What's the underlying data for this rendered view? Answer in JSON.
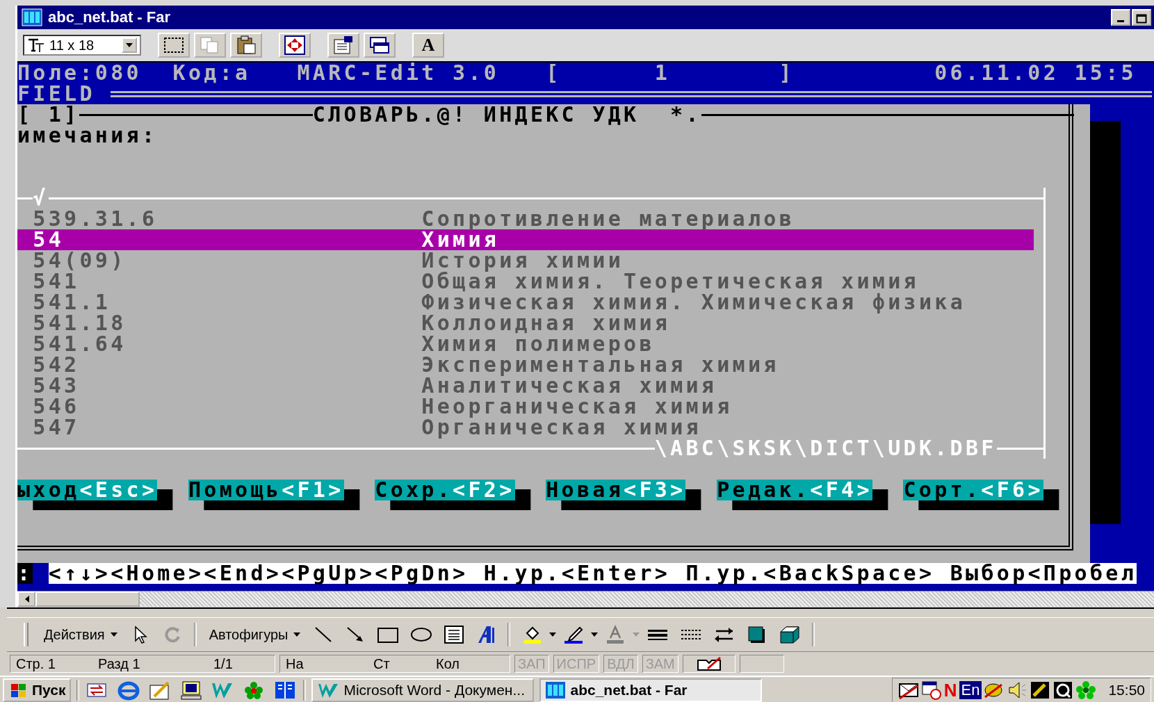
{
  "window": {
    "title": "abc_net.bat - Far",
    "font_size": "11 x 18",
    "font_button": "A"
  },
  "console": {
    "header": {
      "field": "Поле:080",
      "code": "Код:a",
      "app": "MARC-Edit 3.0",
      "bracket_open": "[",
      "record": "1",
      "bracket_close": "]",
      "datetime": "06.11.02 15:5"
    },
    "field_label": "FIELD",
    "dialog": {
      "number": "[ 1]",
      "title": "СЛОВАРЬ.@! ИНДЕКС УДК",
      "filter": "*.",
      "prompt": "имечания:",
      "mark": "√",
      "path": "\\ABC\\SKSK\\DICT\\UDK.DBF",
      "items": [
        {
          "code": "539.31.6",
          "name": "Сопротивление материалов",
          "selected": false
        },
        {
          "code": "54",
          "name": "Химия",
          "selected": true
        },
        {
          "code": "54(09)",
          "name": "История химии",
          "selected": false
        },
        {
          "code": "541",
          "name": "Общая химия. Теоретическая химия",
          "selected": false
        },
        {
          "code": "541.1",
          "name": "Физическая химия. Химическая физика",
          "selected": false
        },
        {
          "code": "541.18",
          "name": "Коллоидная химия",
          "selected": false
        },
        {
          "code": "541.64",
          "name": "Химия полимеров",
          "selected": false
        },
        {
          "code": "542",
          "name": "Экспериментальная химия",
          "selected": false
        },
        {
          "code": "543",
          "name": "Аналитическая химия",
          "selected": false
        },
        {
          "code": "546",
          "name": "Неорганическая химия",
          "selected": false
        },
        {
          "code": "547",
          "name": "Органическая химия",
          "selected": false
        }
      ],
      "buttons": [
        {
          "label": "ыход",
          "key": "<Esc>"
        },
        {
          "label": "Помощь",
          "key": "<F1>"
        },
        {
          "label": "Сохр.",
          "key": "<F2>"
        },
        {
          "label": "Новая",
          "key": "<F3>"
        },
        {
          "label": "Редак.",
          "key": "<F4>"
        },
        {
          "label": "Сорт.",
          "key": "<F6>"
        }
      ]
    },
    "hint": {
      "prompt": ":",
      "keys": "<↑↓><Home><End><PgUp><PgDn> Н.ур.<Enter> П.ур.<BackSpace> Выбор<Пробел"
    }
  },
  "word": {
    "drawing_toolbar": {
      "actions": "Действия",
      "autoshapes": "Автофигуры"
    },
    "status_bar": {
      "page": "Стр. 1",
      "section": "Разд 1",
      "pages": "1/1",
      "at": "На",
      "line": "Ст",
      "column": "Кол",
      "indicators": [
        {
          "label": "ЗАП",
          "active": false
        },
        {
          "label": "ИСПР",
          "active": false
        },
        {
          "label": "ВДЛ",
          "active": false
        },
        {
          "label": "ЗАМ",
          "active": false
        }
      ]
    }
  },
  "taskbar": {
    "start": "Пуск",
    "tasks": [
      {
        "label": "Microsoft Word - Докумен...",
        "selected": false
      },
      {
        "label": "abc_net.bat - Far",
        "selected": true
      }
    ],
    "tray_n": "N",
    "language": "En",
    "clock": "15:50"
  }
}
